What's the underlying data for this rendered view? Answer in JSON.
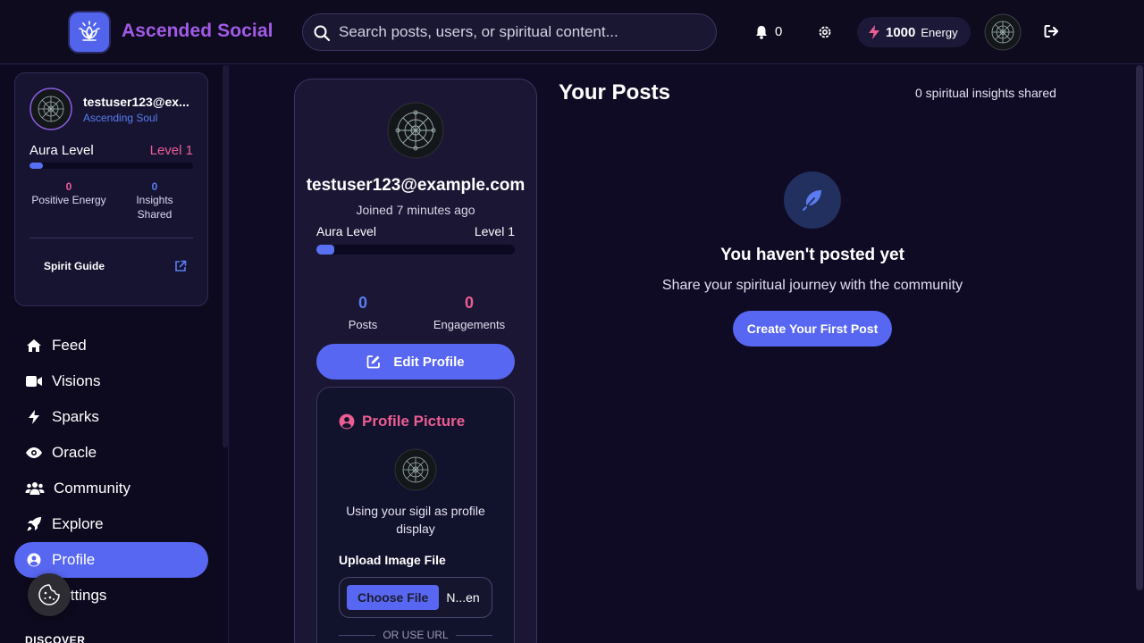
{
  "header": {
    "app_title": "Ascended Social",
    "search_placeholder": "Search posts, users, or spiritual content...",
    "notification_count": "0",
    "energy_amount": "1000",
    "energy_unit": "Energy"
  },
  "sidebar": {
    "user": {
      "name": "testuser123@ex...",
      "rank": "Ascending Soul",
      "aura_label": "Aura Level",
      "aura_level": "Level 1",
      "aura_progress": 0.08,
      "positive_energy_value": "0",
      "positive_energy_label": "Positive Energy",
      "insights_value": "0",
      "insights_label": "Insights Shared",
      "spirit_guide": "Spirit Guide"
    },
    "nav": [
      {
        "label": "Feed",
        "icon": "home-icon"
      },
      {
        "label": "Visions",
        "icon": "video-icon"
      },
      {
        "label": "Sparks",
        "icon": "bolt-icon"
      },
      {
        "label": "Oracle",
        "icon": "eye-icon"
      },
      {
        "label": "Community",
        "icon": "users-icon"
      },
      {
        "label": "Explore",
        "icon": "rocket-icon"
      },
      {
        "label": "Profile",
        "icon": "user-circle-icon",
        "active": true
      },
      {
        "label": "Settings",
        "icon": "gear-icon"
      }
    ],
    "section_discover": "DISCOVER"
  },
  "profile": {
    "email": "testuser123@example.com",
    "joined": "Joined 7 minutes ago",
    "aura_label": "Aura Level",
    "aura_level": "Level 1",
    "aura_progress": 0.09,
    "posts_value": "0",
    "posts_label": "Posts",
    "engagements_value": "0",
    "engagements_label": "Engagements",
    "edit_button": "Edit Profile",
    "picture": {
      "title": "Profile Picture",
      "note": "Using your sigil as profile display",
      "upload_label": "Upload Image File",
      "choose_button": "Choose File",
      "file_name": "N...en",
      "or_url": "OR USE URL"
    }
  },
  "posts": {
    "title": "Your Posts",
    "count_text": "0 spiritual insights shared",
    "empty_title": "You haven't posted yet",
    "empty_subtitle": "Share your spiritual journey with the community",
    "create_button": "Create Your First Post"
  },
  "colors": {
    "accent": "#5867f1",
    "brand_text": "#a15be6",
    "pink": "#ec5d94",
    "background": "#0f0b24"
  }
}
